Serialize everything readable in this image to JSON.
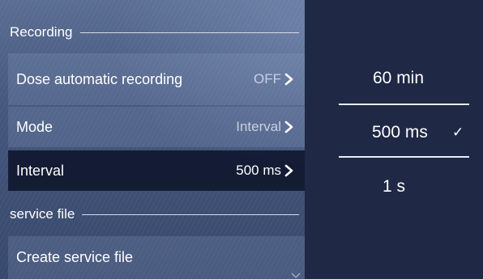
{
  "recording_section": {
    "title": "Recording",
    "rows": [
      {
        "label": "Dose automatic recording",
        "value": "OFF"
      },
      {
        "label": "Mode",
        "value": "Interval"
      },
      {
        "label": "Interval",
        "value": "500 ms",
        "selected": true
      }
    ]
  },
  "service_section": {
    "title": "service file",
    "rows": [
      {
        "label": "Create service file"
      }
    ]
  },
  "picker": {
    "options": [
      "60 min",
      "500 ms",
      "1 s"
    ],
    "selected_index": 1,
    "check_icon": "checkmark-icon"
  },
  "icons": {
    "row_arrow": "chevron-right-icon",
    "scroll_hint": "chevron-down-icon"
  },
  "colors": {
    "panel_blue": "#44567c",
    "selected_row": "#0f162e",
    "picker_background": "#1f2845",
    "text": "#ffffff"
  }
}
